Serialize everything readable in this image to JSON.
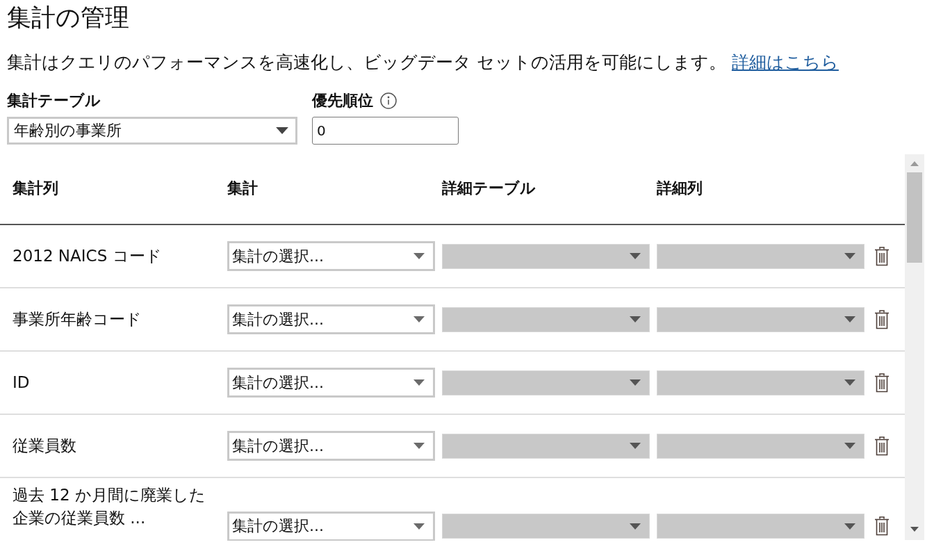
{
  "title": "集計の管理",
  "description": {
    "text": "集計はクエリのパフォーマンスを高速化し、ビッグデータ セットの活用を可能にします。",
    "link": "詳細はこちら"
  },
  "aggregation_table": {
    "label": "集計テーブル",
    "value": "年齢別の事業所"
  },
  "priority": {
    "label": "優先順位",
    "value": "0"
  },
  "table": {
    "columns": [
      "集計列",
      "集計",
      "詳細テーブル",
      "詳細列"
    ],
    "rows": [
      {
        "column": [
          "2012 NAICS コード"
        ],
        "aggregation": {
          "value": "集計の選択...",
          "disabled": false
        },
        "detail_table": {
          "disabled": true
        },
        "detail_column": {
          "disabled": true
        }
      },
      {
        "column": [
          "事業所年齢コード"
        ],
        "aggregation": {
          "value": "集計の選択...",
          "disabled": false
        },
        "detail_table": {
          "disabled": true
        },
        "detail_column": {
          "disabled": true
        }
      },
      {
        "column": [
          "ID"
        ],
        "aggregation": {
          "value": "集計の選択...",
          "disabled": false
        },
        "detail_table": {
          "disabled": true
        },
        "detail_column": {
          "disabled": true
        }
      },
      {
        "column": [
          "従業員数"
        ],
        "aggregation": {
          "value": "集計の選択...",
          "disabled": false
        },
        "detail_table": {
          "disabled": true
        },
        "detail_column": {
          "disabled": true
        }
      },
      {
        "column": [
          "過去 12 か月間に廃業した",
          "企業の従業員数 ..."
        ],
        "aggregation": {
          "value": "集計の選択...",
          "disabled": false
        },
        "detail_table": {
          "disabled": true
        },
        "detail_column": {
          "disabled": true
        }
      }
    ]
  }
}
